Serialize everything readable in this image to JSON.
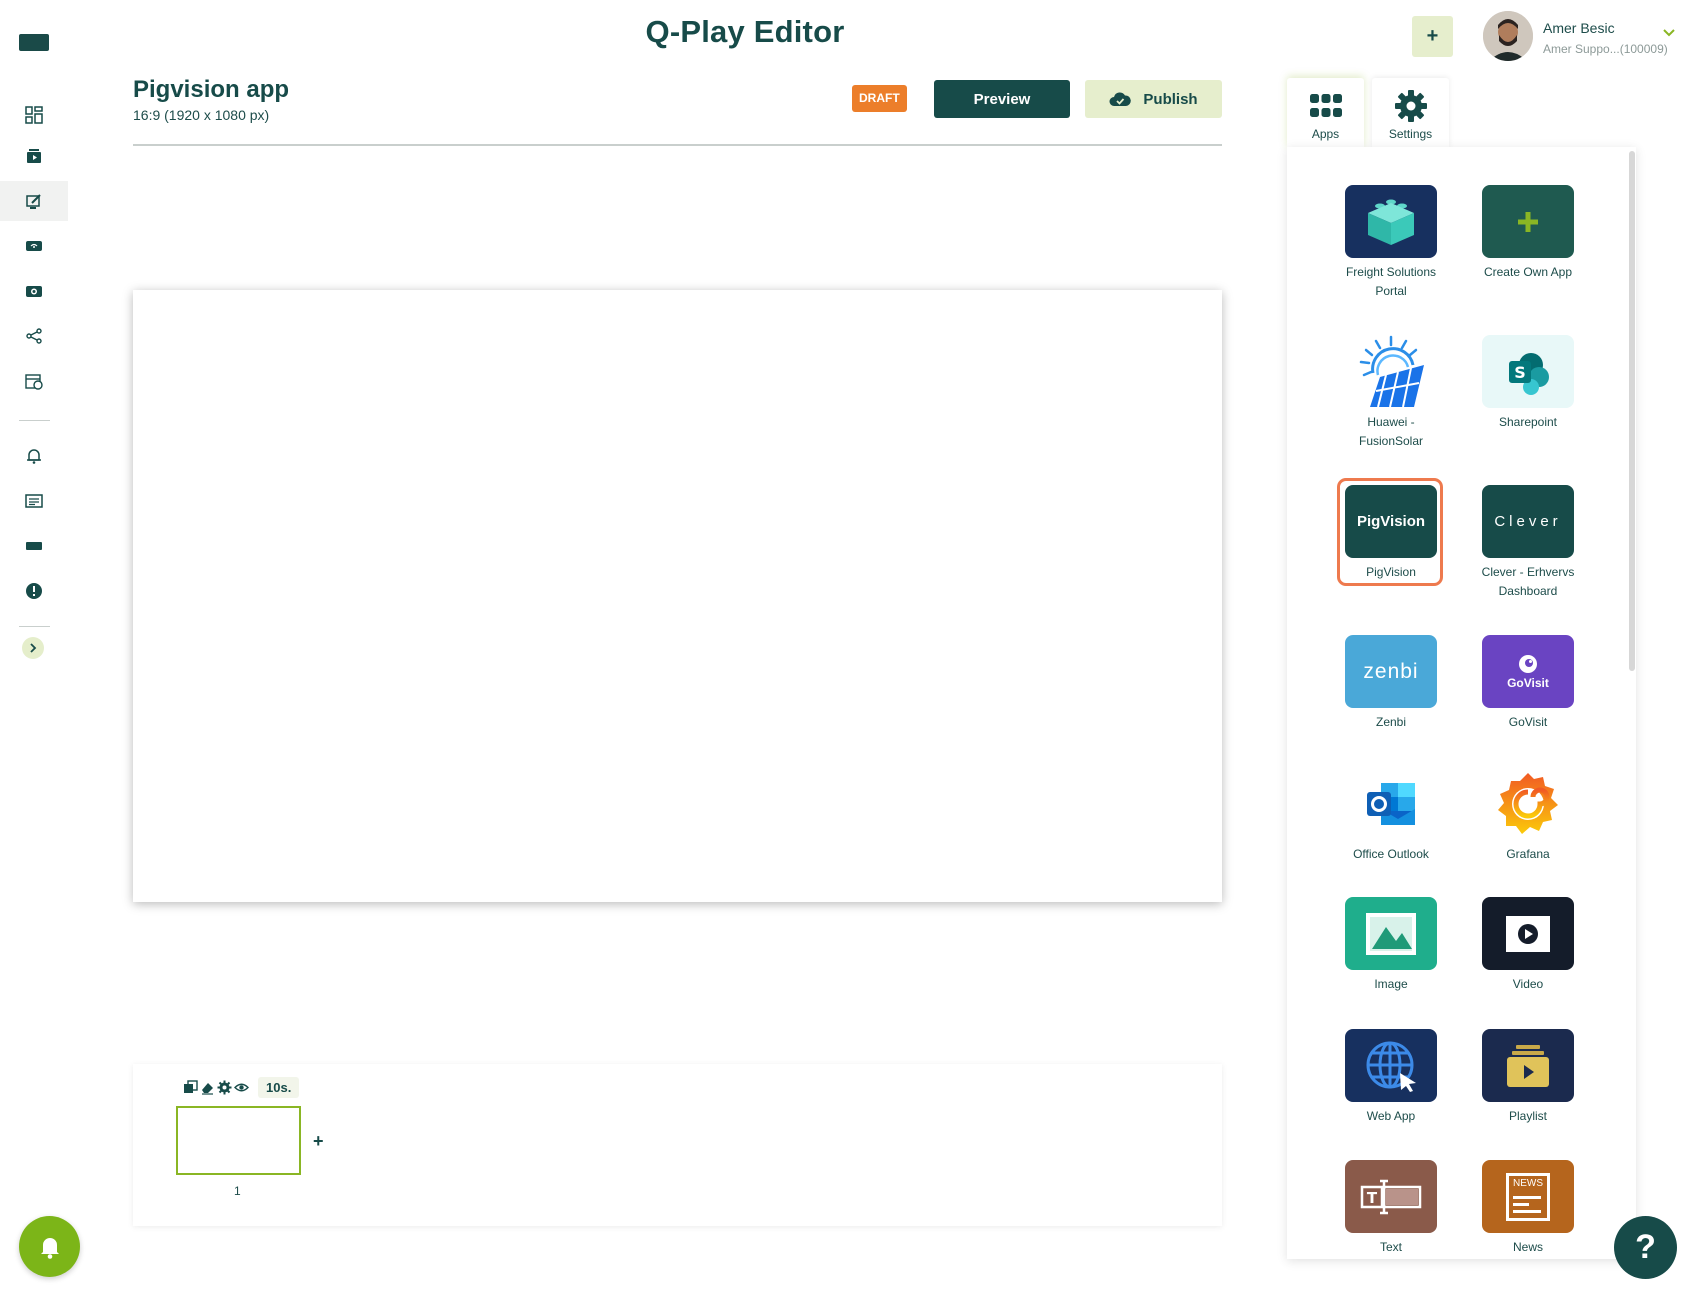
{
  "header": {
    "app_title": "Q-Play Editor",
    "add_button_label": "+",
    "user_name": "Amer Besic",
    "user_subtitle": "Amer Suppo...(100009)"
  },
  "document": {
    "title": "Pigvision app",
    "size": "16:9 (1920 x 1080 px)",
    "status": "DRAFT",
    "preview_label": "Preview",
    "publish_label": "Publish"
  },
  "sidebar": {
    "items": [
      {
        "icon": "dashboard-icon"
      },
      {
        "icon": "media-icon"
      },
      {
        "icon": "editor-icon",
        "active": true
      },
      {
        "icon": "player-icon"
      },
      {
        "icon": "channel-icon"
      },
      {
        "icon": "share-icon"
      },
      {
        "icon": "schedule-icon"
      },
      {
        "icon": "alert-bell-icon"
      },
      {
        "icon": "news-ticker-icon"
      },
      {
        "icon": "screen-icon"
      },
      {
        "icon": "warning-icon"
      }
    ]
  },
  "slides": {
    "duration": "10s.",
    "items": [
      {
        "number": "1"
      }
    ],
    "add_label": "+"
  },
  "panel": {
    "tabs": [
      {
        "label": "Apps",
        "icon": "apps-grid-icon",
        "selected": true
      },
      {
        "label": "Settings",
        "icon": "gear-icon",
        "selected": false
      }
    ],
    "apps": [
      {
        "label": "Freight Solutions Portal",
        "icon": "cube-icon",
        "bg": "#17305f"
      },
      {
        "label": "Create Own App",
        "icon": "plus-icon",
        "bg": "#1f5a50"
      },
      {
        "label": "Huawei - FusionSolar",
        "icon": "solar-panel-icon",
        "bg": "#ffffff"
      },
      {
        "label": "Sharepoint",
        "icon": "sharepoint-icon",
        "bg": "#e8f8f8"
      },
      {
        "label": "PigVision",
        "icon": "pigvision-logo",
        "bg": "#174b49",
        "logo_text": "PigVision",
        "selected": true
      },
      {
        "label": "Clever - Erhvervs Dashboard",
        "icon": "clever-logo",
        "bg": "#174b49",
        "logo_text": "Clever"
      },
      {
        "label": "Zenbi",
        "icon": "zenbi-logo",
        "bg": "#4aa8d8",
        "logo_text": "zenbi"
      },
      {
        "label": "GoVisit",
        "icon": "govisit-logo",
        "bg": "#6a44c2",
        "logo_text": "GoVisit"
      },
      {
        "label": "Office Outlook",
        "icon": "outlook-icon",
        "bg": "#ffffff"
      },
      {
        "label": "Grafana",
        "icon": "grafana-icon",
        "bg": "#ffffff"
      },
      {
        "label": "Image",
        "icon": "image-icon",
        "bg": "#1fae8c"
      },
      {
        "label": "Video",
        "icon": "video-icon",
        "bg": "#141c2a"
      },
      {
        "label": "Web App",
        "icon": "globe-icon",
        "bg": "#17305f"
      },
      {
        "label": "Playlist",
        "icon": "playlist-icon",
        "bg": "#1b2a4e"
      },
      {
        "label": "Text",
        "icon": "text-icon",
        "bg": "#8a5a4a"
      },
      {
        "label": "News",
        "icon": "news-icon",
        "bg": "#b5651d",
        "logo_text": "NEWS"
      }
    ]
  },
  "help_label": "?"
}
